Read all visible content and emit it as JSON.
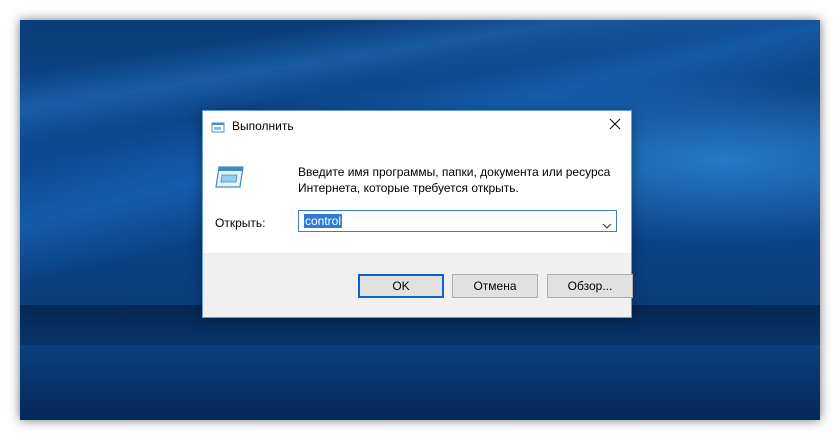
{
  "dialog": {
    "title": "Выполнить",
    "prompt": "Введите имя программы, папки, документа или ресурса Интернета, которые требуется открыть.",
    "open_label": "Открыть:",
    "input_value": "control",
    "buttons": {
      "ok": "OK",
      "cancel": "Отмена",
      "browse": "Обзор..."
    }
  },
  "icons": {
    "title": "run-icon",
    "body": "run-icon",
    "close": "close-icon",
    "dropdown": "chevron-down-icon"
  },
  "colors": {
    "desktop_blue": "#0b4a92",
    "selection": "#2f7bd3",
    "focus_border": "#0a64c8"
  }
}
